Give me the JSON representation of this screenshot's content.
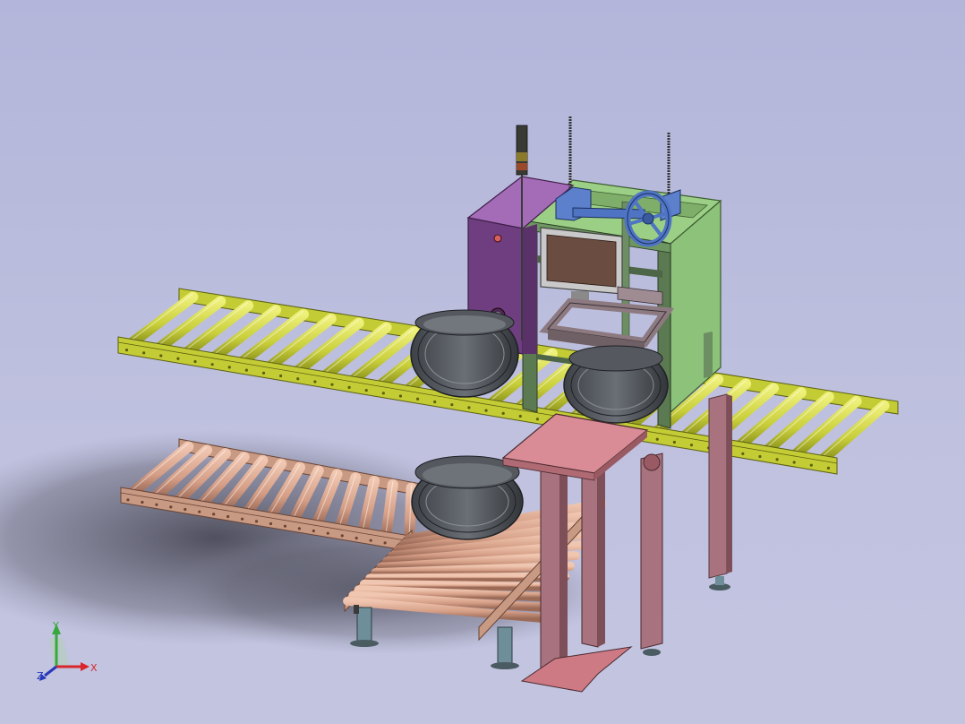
{
  "triad": {
    "x_label": "X",
    "y_label": "Y",
    "z_label": "Z"
  },
  "colors": {
    "background_top": "#b3b5da",
    "background_bottom": "#c3c5e0",
    "main_conveyor_rail": "#c4cc35",
    "main_conveyor_roller": "#dde45a",
    "lower_conveyor_rail": "#c89a84",
    "lower_conveyor_roller": "#e0b09a",
    "cabinet_purple": "#8a4a9c",
    "frame_green": "#9bcf85",
    "control_blue": "#4f74c4",
    "screen_brown": "#6b4c40",
    "rim_dark": "#55595f",
    "table_pink": "#cd7a84",
    "leg_pink": "#a8727e",
    "foot_gray": "#5f7c86",
    "shadow": "#4a4a55",
    "x_axis": "#d8262c",
    "y_axis": "#37a83c",
    "z_axis": "#2838b8"
  }
}
